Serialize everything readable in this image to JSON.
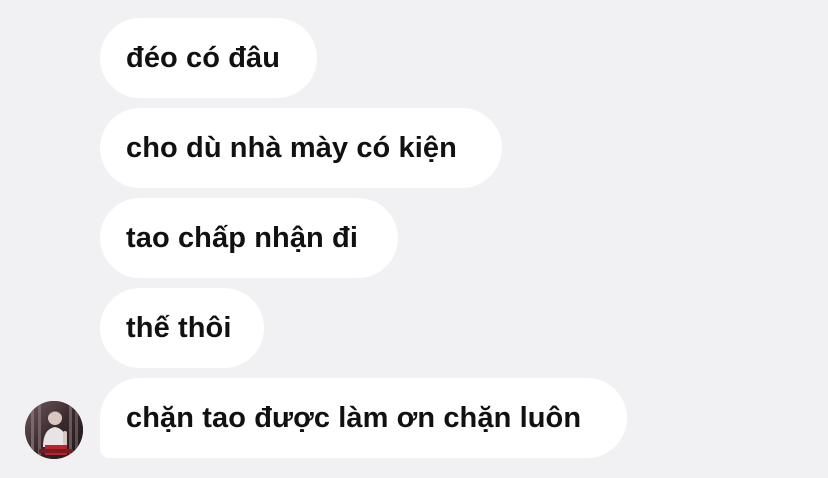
{
  "messages": [
    {
      "text": "đéo có đâu"
    },
    {
      "text": "cho dù nhà mày có kiện"
    },
    {
      "text": "tao chấp nhận đi"
    },
    {
      "text": "thế thôi"
    },
    {
      "text": "chặn tao được làm ơn chặn luôn"
    }
  ],
  "sender": {
    "avatar_icon": "user-avatar-photo"
  },
  "colors": {
    "background": "#f1f1f3",
    "bubble": "#ffffff",
    "text": "#111111"
  }
}
